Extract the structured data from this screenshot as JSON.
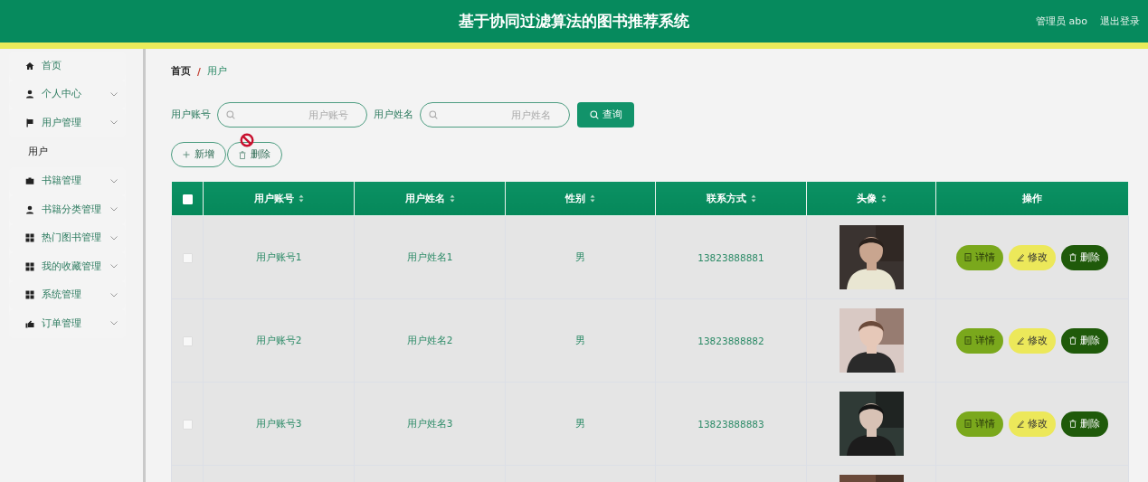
{
  "header": {
    "title": "基于协同过滤算法的图书推荐系统",
    "user": "管理员 abo",
    "logout": "退出登录"
  },
  "sidebar": {
    "items": [
      {
        "label": "首页",
        "kind": "home",
        "expandable": false
      },
      {
        "label": "个人中心",
        "kind": "user",
        "expandable": true
      },
      {
        "label": "用户管理",
        "kind": "flag",
        "expandable": true,
        "children": [
          {
            "label": "用户",
            "selected": true
          }
        ]
      },
      {
        "label": "书籍管理",
        "kind": "briefcase",
        "expandable": true
      },
      {
        "label": "书籍分类管理",
        "kind": "user",
        "expandable": true
      },
      {
        "label": "热门图书管理",
        "kind": "grid",
        "expandable": true
      },
      {
        "label": "我的收藏管理",
        "kind": "grid",
        "expandable": true
      },
      {
        "label": "系统管理",
        "kind": "grid",
        "expandable": true
      },
      {
        "label": "订单管理",
        "kind": "hand",
        "expandable": true
      }
    ]
  },
  "breadcrumb": {
    "items": [
      "首页",
      "用户"
    ],
    "separator": "/"
  },
  "search": {
    "fields": [
      {
        "label": "用户账号",
        "placeholder": "用户账号"
      },
      {
        "label": "用户姓名",
        "placeholder": "用户姓名"
      }
    ],
    "button": "查询"
  },
  "actions": [
    {
      "kind": "add",
      "label": "新增"
    },
    {
      "kind": "delete",
      "label": "删除"
    }
  ],
  "table": {
    "select_all": {
      "checked": false
    },
    "columns": [
      {
        "label": "用户账号",
        "sortable": true
      },
      {
        "label": "用户姓名",
        "sortable": true
      },
      {
        "label": "性别",
        "sortable": true
      },
      {
        "label": "联系方式",
        "sortable": true
      },
      {
        "label": "头像",
        "sortable": true
      },
      {
        "label": "操作",
        "sortable": false
      }
    ],
    "rows": [
      {
        "checked": false,
        "cells": [
          "用户账号1",
          "用户姓名1",
          "男",
          "13823888881"
        ],
        "avatar": {
          "kind": "picture"
        },
        "actions": [
          {
            "kind": "detail",
            "label": "详情"
          },
          {
            "kind": "edit",
            "label": "修改"
          },
          {
            "kind": "delete",
            "label": "删除"
          }
        ]
      },
      {
        "checked": false,
        "cells": [
          "用户账号2",
          "用户姓名2",
          "男",
          "13823888882"
        ],
        "avatar": {
          "kind": "picture"
        },
        "actions": [
          {
            "kind": "detail",
            "label": "详情"
          },
          {
            "kind": "edit",
            "label": "修改"
          },
          {
            "kind": "delete",
            "label": "删除"
          }
        ]
      },
      {
        "checked": false,
        "cells": [
          "用户账号3",
          "用户姓名3",
          "男",
          "13823888883"
        ],
        "avatar": {
          "kind": "picture"
        },
        "actions": [
          {
            "kind": "detail",
            "label": "详情"
          },
          {
            "kind": "edit",
            "label": "修改"
          },
          {
            "kind": "delete",
            "label": "删除"
          }
        ]
      },
      {
        "avatar": {
          "kind": "picture"
        }
      }
    ]
  }
}
